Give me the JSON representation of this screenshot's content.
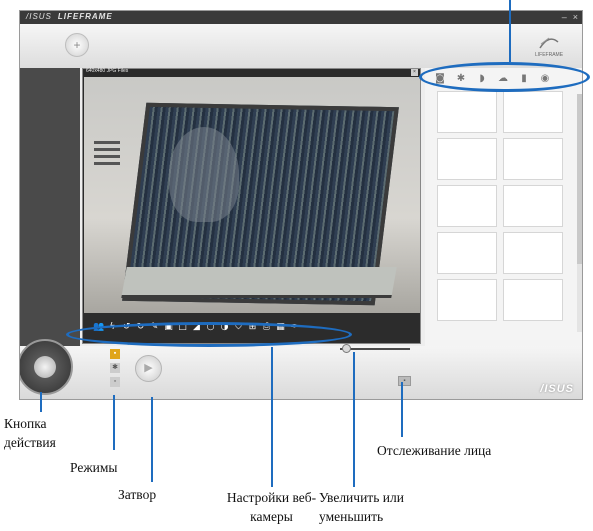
{
  "app": {
    "brand": "/ISUS",
    "title": "LIFEFRAME",
    "window_controls": [
      "–",
      "×"
    ],
    "logo": "LIFEFRAME",
    "footer_brand": "/ISUS",
    "header_button_icon": "add-icon"
  },
  "preview": {
    "label": "640x480 JPG Files",
    "close_icon": "close-icon"
  },
  "right_panel": {
    "icons": [
      "camera-icon",
      "gear-icon",
      "video-icon",
      "scene-icon",
      "mic-icon",
      "eye-icon"
    ],
    "thumbnails_count": 10
  },
  "toolbar": {
    "icons": [
      "people-icon",
      "flash-icon",
      "rotate-left-icon",
      "rotate-right-icon",
      "pen-icon",
      "frame-icon",
      "crop-icon",
      "triangle-icon",
      "circle-icon",
      "contrast-icon",
      "shield-icon",
      "grid-icon",
      "print-icon",
      "color-icon",
      "wrench-icon"
    ]
  },
  "modes": [
    "photo-mode",
    "settings-mode",
    "video-mode"
  ],
  "annotations": {
    "action_button": "Кнопка действия",
    "modes": "Режимы",
    "shutter": "Затвор",
    "webcam_settings": "Настройки веб-камеры",
    "zoom": "Увеличить или уменьшить",
    "face_tracking": "Отслеживание лица"
  },
  "colors": {
    "highlight": "#1e6cbf",
    "active_mode": "#e0a51a"
  }
}
